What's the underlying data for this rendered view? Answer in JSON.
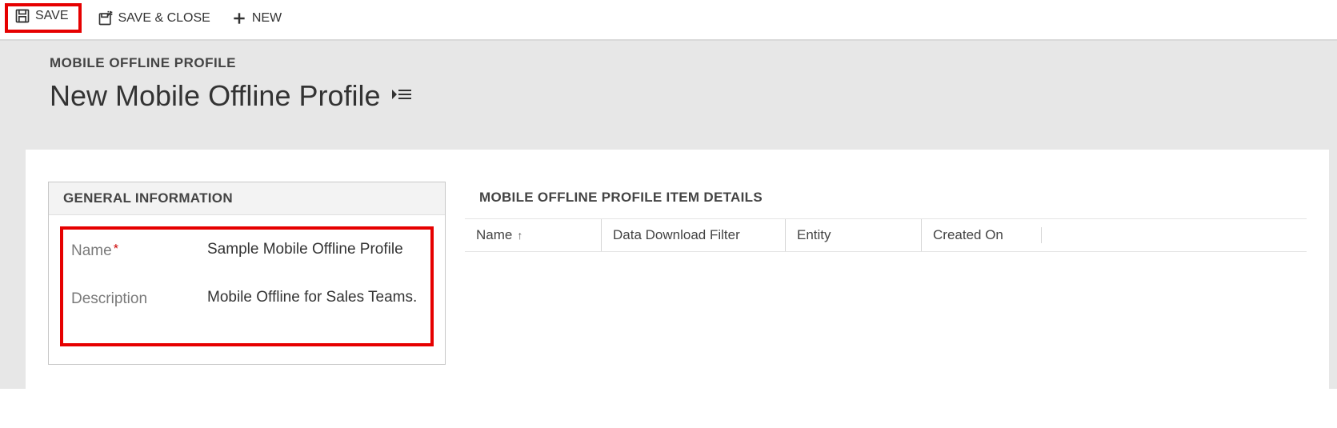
{
  "toolbar": {
    "save_label": "SAVE",
    "save_close_label": "SAVE & CLOSE",
    "new_label": "NEW"
  },
  "header": {
    "breadcrumb": "MOBILE OFFLINE PROFILE",
    "title": "New Mobile Offline Profile"
  },
  "general_info": {
    "panel_title": "GENERAL INFORMATION",
    "name_label": "Name",
    "name_value": "Sample Mobile Offline Profile",
    "description_label": "Description",
    "description_value": "Mobile Offline for Sales Teams."
  },
  "item_details": {
    "panel_title": "MOBILE OFFLINE PROFILE ITEM DETAILS",
    "columns": {
      "name": "Name",
      "filter": "Data Download Filter",
      "entity": "Entity",
      "created": "Created On"
    },
    "sort_indicator": "↑"
  }
}
